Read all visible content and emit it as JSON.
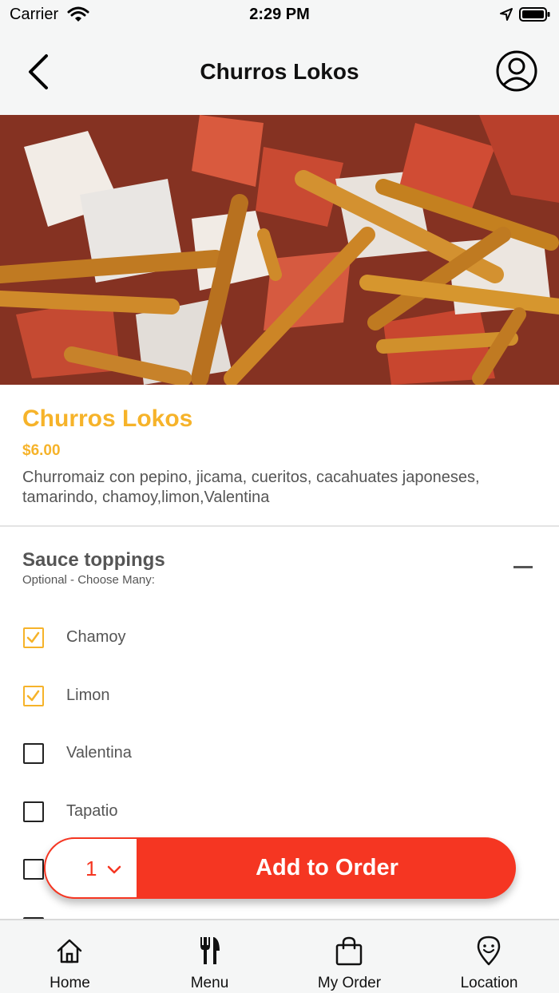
{
  "status_bar": {
    "carrier": "Carrier",
    "time": "2:29 PM"
  },
  "nav": {
    "title": "Churros Lokos",
    "back_icon": "chevron-left-icon",
    "profile_icon": "user-circle-icon"
  },
  "item": {
    "name": "Churros Lokos",
    "price": "$6.00",
    "description": "Churromaiz con pepino, jicama, cueritos, cacahuates japoneses, tamarindo, chamoy,limon,Valentina"
  },
  "section": {
    "title": "Sauce toppings",
    "subtitle": "Optional - Choose Many:"
  },
  "options": [
    {
      "label": "Chamoy",
      "checked": true
    },
    {
      "label": "Limon",
      "checked": true
    },
    {
      "label": "Valentina",
      "checked": false
    },
    {
      "label": "Tapatio",
      "checked": false
    }
  ],
  "order": {
    "quantity": "1",
    "add_label": "Add to Order"
  },
  "tabs": [
    {
      "label": "Home",
      "icon": "home-icon"
    },
    {
      "label": "Menu",
      "icon": "fork-knife-icon"
    },
    {
      "label": "My Order",
      "icon": "shopping-bag-icon"
    },
    {
      "label": "Location",
      "icon": "map-pin-icon"
    }
  ],
  "colors": {
    "accent": "#f6b32a",
    "order_red": "#f53622",
    "bar_bg": "#f5f6f6"
  }
}
